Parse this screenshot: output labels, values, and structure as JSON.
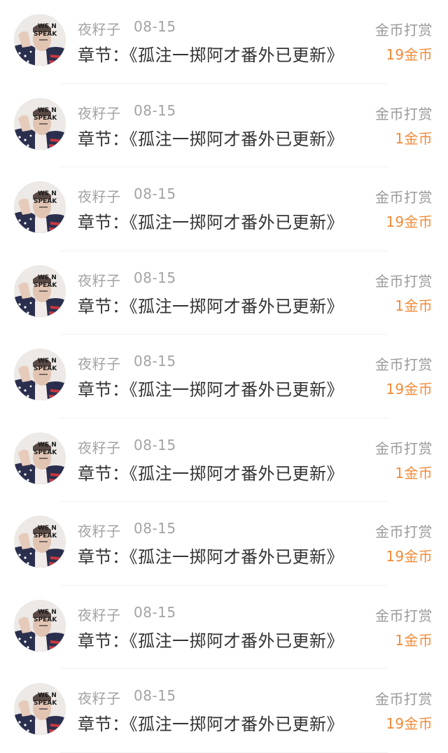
{
  "colors": {
    "name_text": "#a3a3a3",
    "chapter_text": "#333333",
    "action_text": "#999999",
    "amount_text": "#f28a36",
    "divider": "#f1f1f1"
  },
  "records": [
    {
      "username": "夜籽子",
      "date": "08-15",
      "chapter": "章节：《孤注一掷阿才番外已更新》",
      "action": "金币打赏",
      "amount": "19金币",
      "avatar_icon": "user-avatar-icon"
    },
    {
      "username": "夜籽子",
      "date": "08-15",
      "chapter": "章节：《孤注一掷阿才番外已更新》",
      "action": "金币打赏",
      "amount": "1金币",
      "avatar_icon": "user-avatar-icon"
    },
    {
      "username": "夜籽子",
      "date": "08-15",
      "chapter": "章节：《孤注一掷阿才番外已更新》",
      "action": "金币打赏",
      "amount": "19金币",
      "avatar_icon": "user-avatar-icon"
    },
    {
      "username": "夜籽子",
      "date": "08-15",
      "chapter": "章节：《孤注一掷阿才番外已更新》",
      "action": "金币打赏",
      "amount": "1金币",
      "avatar_icon": "user-avatar-icon"
    },
    {
      "username": "夜籽子",
      "date": "08-15",
      "chapter": "章节：《孤注一掷阿才番外已更新》",
      "action": "金币打赏",
      "amount": "19金币",
      "avatar_icon": "user-avatar-icon"
    },
    {
      "username": "夜籽子",
      "date": "08-15",
      "chapter": "章节：《孤注一掷阿才番外已更新》",
      "action": "金币打赏",
      "amount": "1金币",
      "avatar_icon": "user-avatar-icon"
    },
    {
      "username": "夜籽子",
      "date": "08-15",
      "chapter": "章节：《孤注一掷阿才番外已更新》",
      "action": "金币打赏",
      "amount": "19金币",
      "avatar_icon": "user-avatar-icon"
    },
    {
      "username": "夜籽子",
      "date": "08-15",
      "chapter": "章节：《孤注一掷阿才番外已更新》",
      "action": "金币打赏",
      "amount": "1金币",
      "avatar_icon": "user-avatar-icon"
    },
    {
      "username": "夜籽子",
      "date": "08-15",
      "chapter": "章节：《孤注一掷阿才番外已更新》",
      "action": "金币打赏",
      "amount": "19金币",
      "avatar_icon": "user-avatar-icon"
    }
  ]
}
